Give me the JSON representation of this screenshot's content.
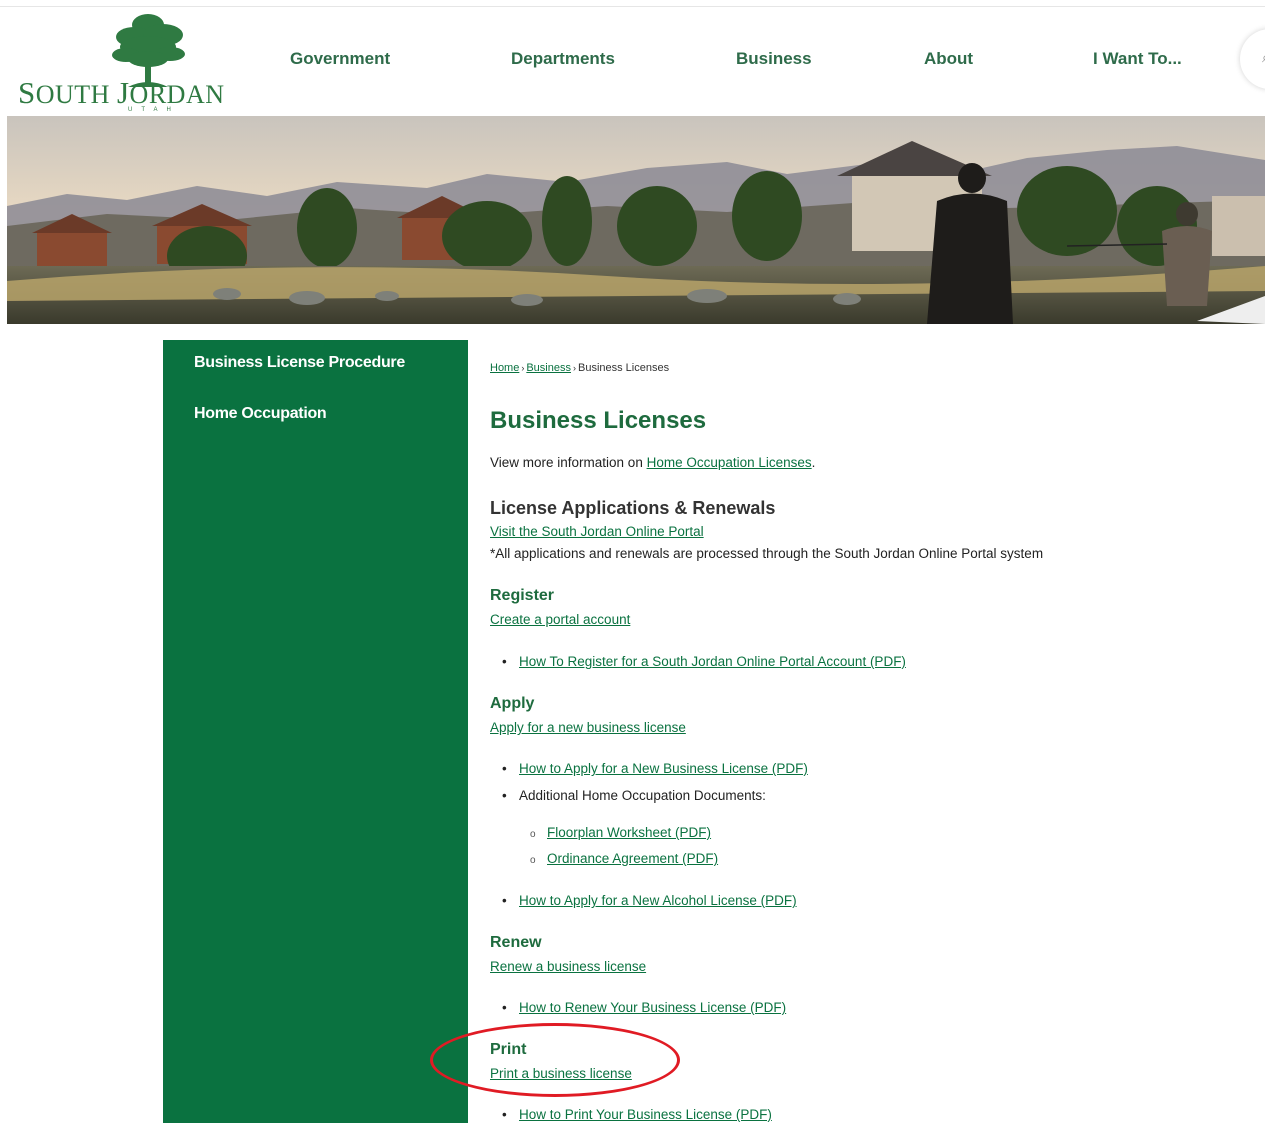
{
  "logo": {
    "text_first": "S",
    "text_rest": "OUTH ",
    "text_second": "J",
    "text_rest2": "ORDAN",
    "subtitle": "UTAH"
  },
  "nav": {
    "items": [
      "Government",
      "Departments",
      "Business",
      "About",
      "I Want To..."
    ]
  },
  "sidebar": {
    "items": [
      "Business License Procedure",
      "Home Occupation"
    ]
  },
  "breadcrumb": {
    "home": "Home",
    "business": "Business",
    "current": "Business Licenses",
    "separator": "›"
  },
  "page": {
    "title": "Business Licenses",
    "intro_text": "View more information on ",
    "intro_link": "Home Occupation Licenses",
    "intro_end": ".",
    "applications": {
      "heading": "License Applications & Renewals",
      "link": "Visit the South Jordan Online Portal",
      "note": "*All applications and renewals are processed through the South Jordan Online Portal system"
    },
    "register": {
      "heading": "Register",
      "link": "Create a portal account",
      "bullets": [
        "How To Register for a South Jordan Online Portal Account (PDF)"
      ]
    },
    "apply": {
      "heading": "Apply",
      "link": "Apply for a new business license",
      "bullet1": "How to Apply for a New Business License (PDF)",
      "bullet2": "Additional Home Occupation Documents:",
      "sub_bullets": [
        "Floorplan Worksheet (PDF)",
        "Ordinance Agreement (PDF)"
      ],
      "bullet3": "How to Apply for a New Alcohol License (PDF)"
    },
    "renew": {
      "heading": "Renew",
      "link": "Renew a business license",
      "bullets": [
        "How to Renew Your Business License (PDF)"
      ]
    },
    "print": {
      "heading": "Print",
      "link": "Print a business license",
      "bullets": [
        "How to Print Your Business License (PDF)"
      ]
    }
  },
  "colors": {
    "brand_green": "#0a7240",
    "heading_green": "#1e6b3e",
    "highlight_red": "#e01b24"
  },
  "icons": {
    "search": "search-icon",
    "tree": "tree-logo-icon"
  }
}
